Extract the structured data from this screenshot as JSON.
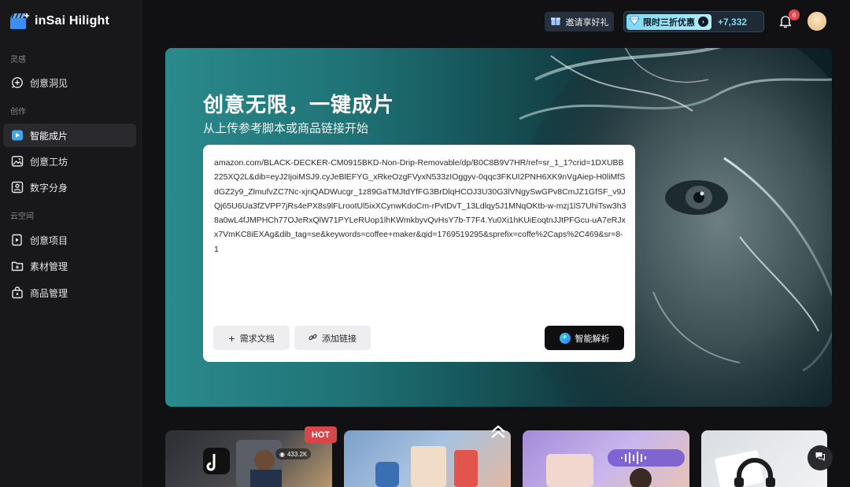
{
  "app": {
    "name": "inSai Hilight"
  },
  "sidebar": {
    "sections": [
      {
        "label": "灵感"
      },
      {
        "label": "创作"
      },
      {
        "label": "云空间"
      }
    ],
    "items": [
      {
        "label": "创意洞见",
        "icon": "lightbulb-icon",
        "active": false
      },
      {
        "label": "智能成片",
        "icon": "play-icon",
        "active": true
      },
      {
        "label": "创意工坊",
        "icon": "image-icon",
        "active": false
      },
      {
        "label": "数字分身",
        "icon": "person-card-icon",
        "active": false
      },
      {
        "label": "创意项目",
        "icon": "project-icon",
        "active": false
      },
      {
        "label": "素材管理",
        "icon": "folder-plus-icon",
        "active": false
      },
      {
        "label": "商品管理",
        "icon": "bag-icon",
        "active": false
      }
    ]
  },
  "topbar": {
    "invite_label": "邀请享好礼",
    "promo_label": "限时三折优惠",
    "promo_count": "+7,332",
    "notification_count": "6"
  },
  "hero": {
    "title": "创意无限，一键成片",
    "subtitle": "从上传参考脚本或商品链接开始",
    "input_value": "amazon.com/BLACK-DECKER-CM0915BKD-Non-Drip-Removable/dp/B0C8B9V7HR/ref=sr_1_1?crid=1DXUBB225XQ2L&dib=eyJ2IjoiMSJ9.cyJeBlEFYG_xRkeOzgFVyxN533zIOggyv-0qqc3FKUI2PNH6XK9nVgAiep-H0liMfSdGZ2y9_ZlmufvZC7Nc-xjnQADWucgr_1z89GaTMJtdYfFG3BrDlqHCOJ3U30G3lVNgySwGPv8CmJZ1GfSF_v9JQj65U6Ua3fZVPP7jRs4ePX8s9lFLrootUl5ixXCynwKdoCm-rPvtDvT_13Ldlqy5J1MNqOKtb-w-mzj1lS7UhiTsw3h38a0wL4fJMPHCh77OJeRxQlW71PYLeRUop1lhKWmkbyvQvHsY7b-T7F4.Yu0Xi1hKUiEoqtnJJtPFGcu-uA7eRJxx7VmKC8iEXAg&dib_tag=se&keywords=coffee+maker&qid=1769519295&sprefix=coffe%2Caps%2C469&sr=8-1",
    "req_doc_label": "需求文档",
    "add_link_label": "添加链接",
    "analyze_label": "智能解析"
  },
  "gallery": {
    "hot_badge": "HOT",
    "views": "433.2K"
  },
  "colors": {
    "accent": "#43c8f0",
    "hot": "#d8464a",
    "badge": "#e5484d"
  }
}
